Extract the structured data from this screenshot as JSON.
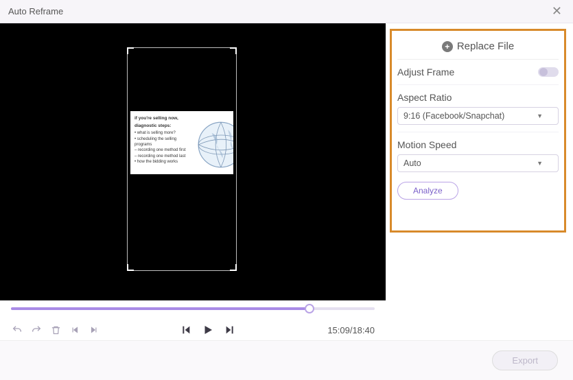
{
  "window": {
    "title": "Auto Reframe"
  },
  "panel": {
    "replace_file_label": "Replace File",
    "adjust_frame_label": "Adjust Frame",
    "adjust_frame_on": false,
    "aspect_ratio_label": "Aspect Ratio",
    "aspect_ratio_value": "9:16 (Facebook/Snapchat)",
    "motion_speed_label": "Motion Speed",
    "motion_speed_value": "Auto",
    "analyze_label": "Analyze"
  },
  "player": {
    "position_pct": 82,
    "current_time": "15:09",
    "total_time": "18:40",
    "timecode": "15:09/18:40"
  },
  "footer": {
    "export_label": "Export"
  },
  "preview": {
    "heading1": "if you're selling now,",
    "heading2": "diagnostic steps:",
    "bullets": "• what is selling more?\n• scheduling the selling programs\n  – recording one method first\n  – recording one method last\n• how the bidding works"
  }
}
